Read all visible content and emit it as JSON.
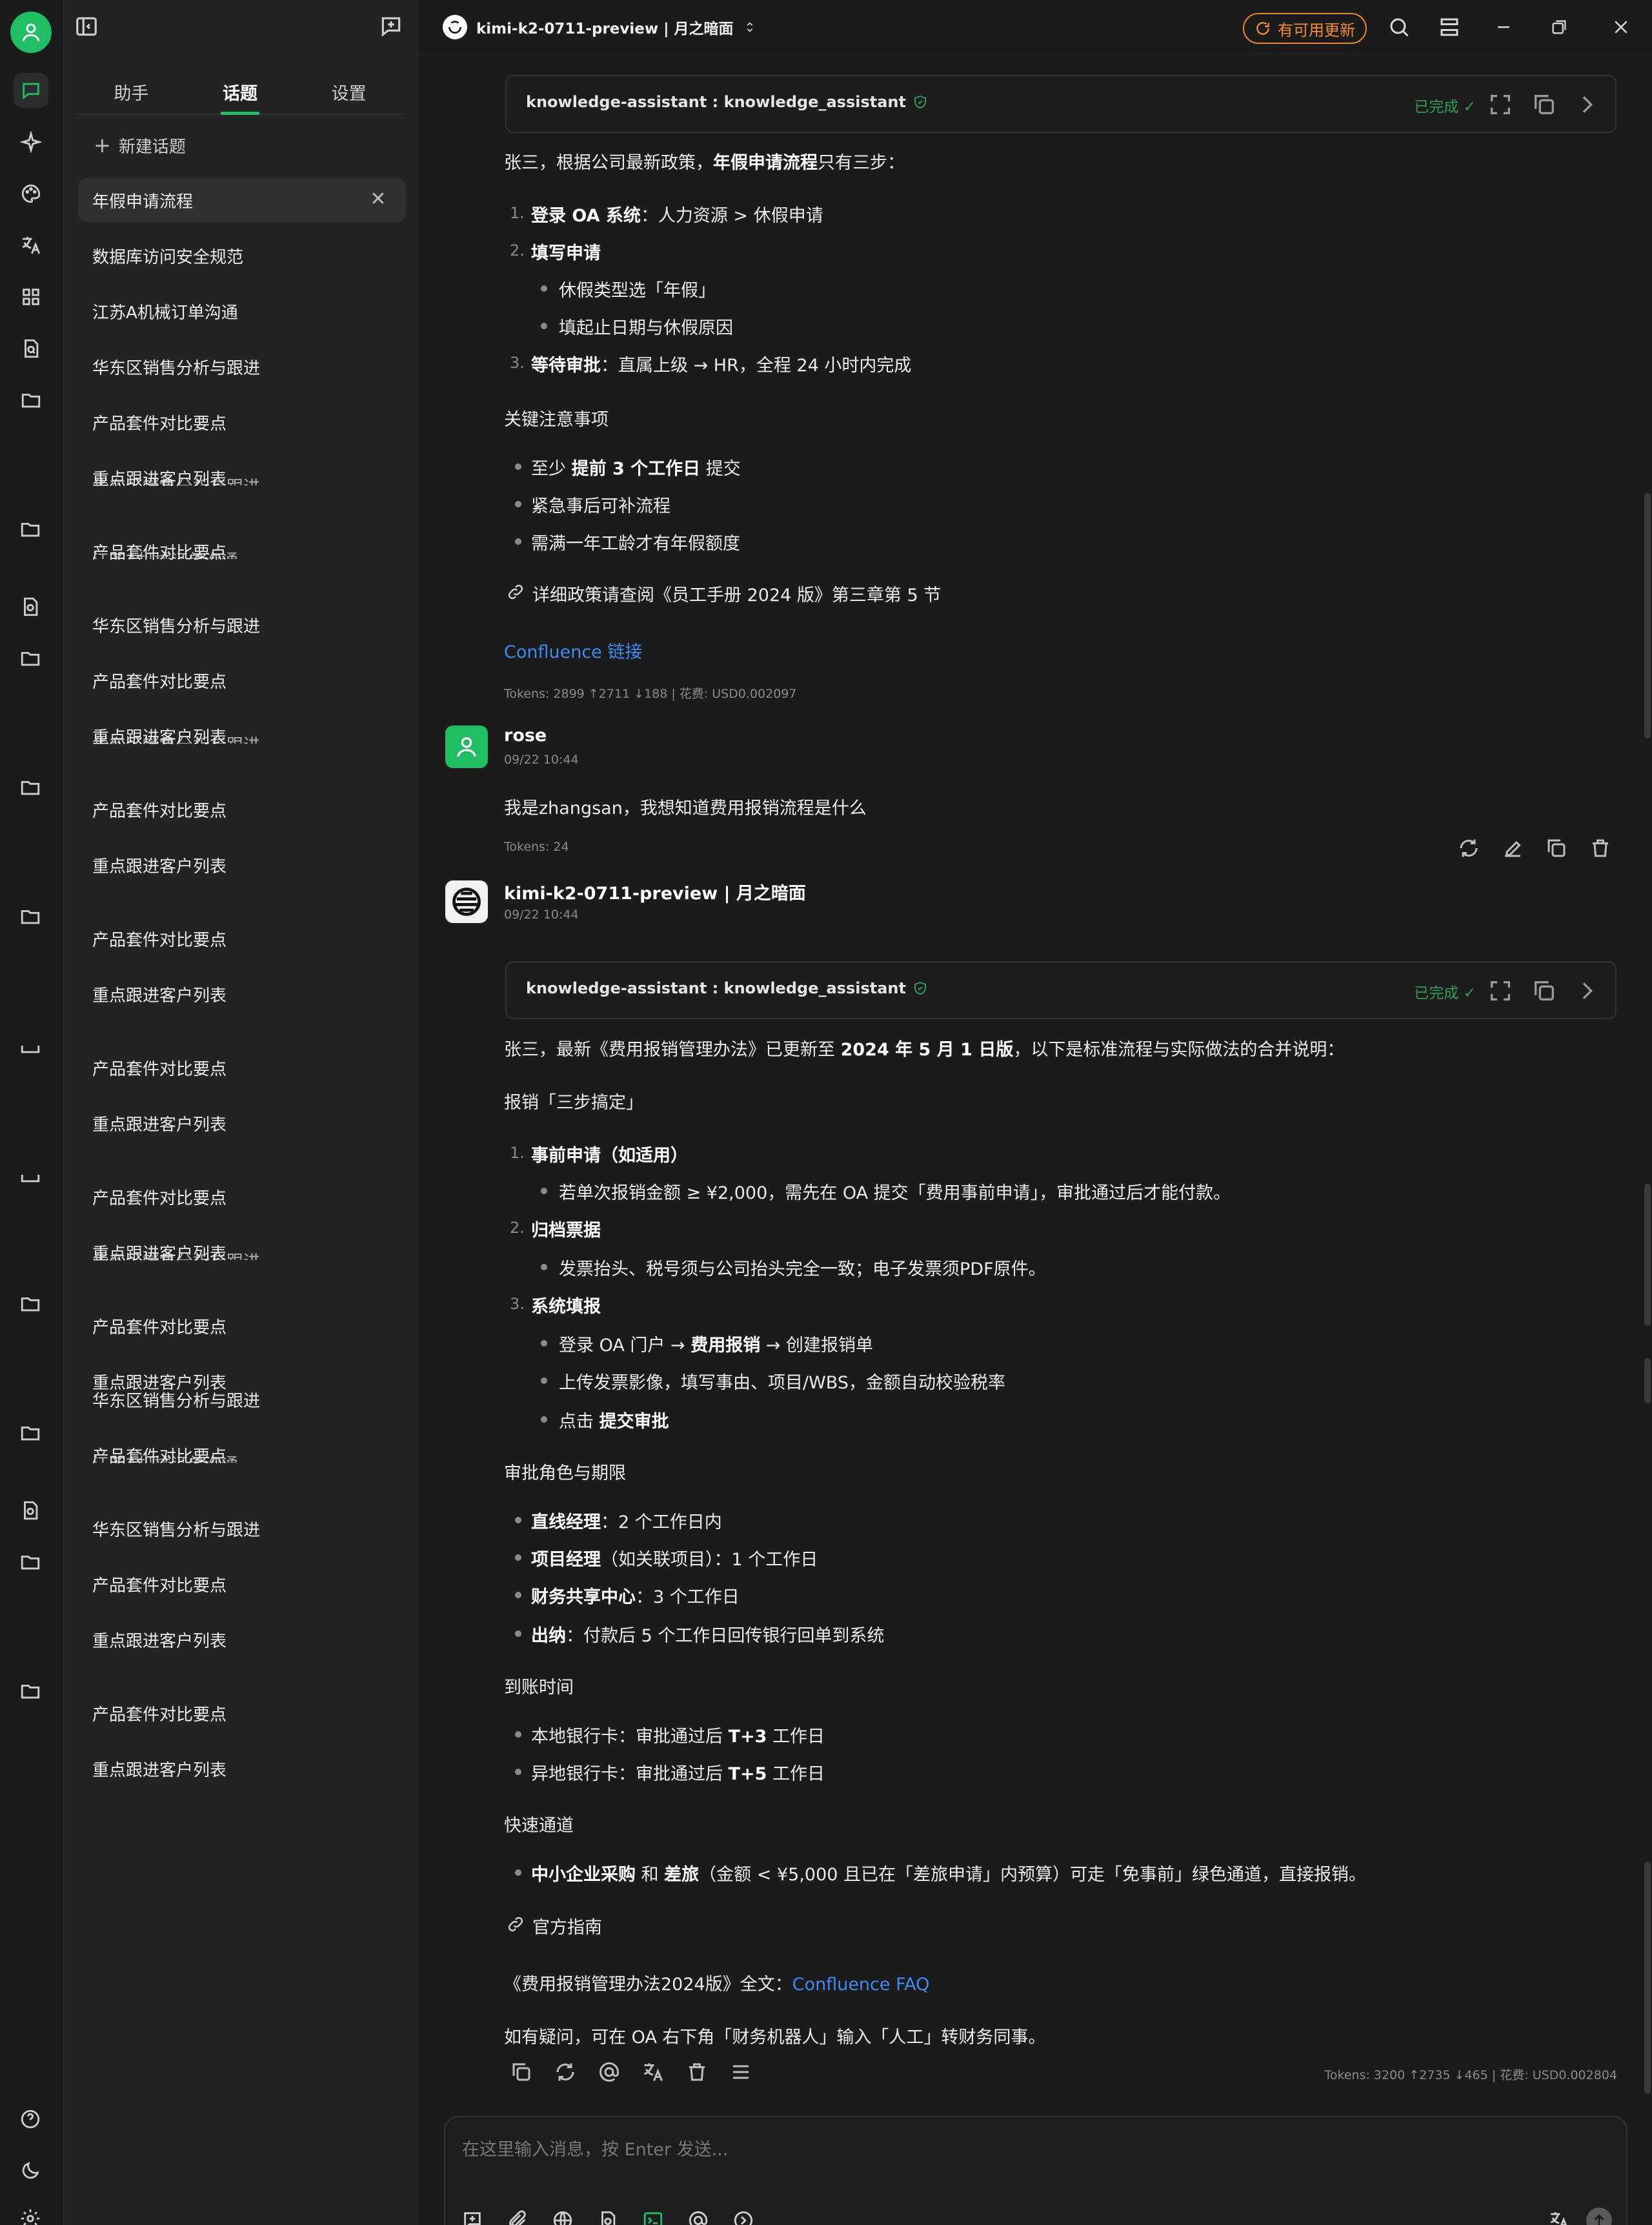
{
  "app": {
    "model_name": "kimi-k2-0711-preview | 月之暗面",
    "update_label": "有可用更新"
  },
  "sidebar_tabs": [
    "助手",
    "话题",
    "设置"
  ],
  "new_topic_label": "新建话题",
  "topics": [
    "年假申请流程",
    "数据库访问安全规范",
    "江苏A机械订单沟通",
    "华东区销售分析与跟进",
    "产品套件对比要点",
    "重点跟进客户列表",
    "华东区销售分析与跟进",
    "产品套件对比要点",
    "江苏A机械订单沟通",
    "华东区销售分析与跟进",
    "产品套件对比要点",
    "重点跟进客户列表",
    "华东区销售分析与跟进",
    "产品套件对比要点",
    "重点跟进客户列表",
    "产品套件对比要点",
    "重点跟进客户列表",
    "产品套件对比要点",
    "重点跟进客户列表",
    "产品套件对比要点",
    "重点跟进客户列表",
    "华东区销售分析与跟进",
    "产品套件对比要点",
    "重点跟进客户列表",
    "华东区销售分析与跟进",
    "产品套件对比要点",
    "江苏A机械订单沟通",
    "华东区销售分析与跟进",
    "产品套件对比要点",
    "重点跟进客户列表",
    "产品套件对比要点",
    "重点跟进客户列表"
  ],
  "tool_card": {
    "title": "knowledge-assistant : knowledge_assistant",
    "status": "已完成"
  },
  "msg1": {
    "intro_a": "张三，根据公司最新政策，",
    "intro_b": "年假申请流程",
    "intro_c": "只有三步：",
    "step1_num": "1.",
    "step1_b": "登录 OA 系统",
    "step1_t": "：人力资源 > 休假申请",
    "step2_num": "2.",
    "step2_b": "填写申请",
    "step2_sub1": "休假类型选「年假」",
    "step2_sub2": "填起止日期与休假原因",
    "step3_num": "3.",
    "step3_b": "等待审批",
    "step3_t": "：直属上级 → HR，全程 24 小时内完成",
    "notes_title": "关键注意事项",
    "note1_a": "至少 ",
    "note1_b": "提前 3 个工作日",
    "note1_c": " 提交",
    "note2": "紧急事后可补流程",
    "note3": "需满一年工龄才有年假额度",
    "policy_ref": "详细政策请查阅《员工手册 2024 版》第三章第 5 节",
    "confluence_link": "Confluence 链接",
    "tokens": "Tokens: 2899 ↑2711 ↓188 | 花费: USD0.002097"
  },
  "msg2": {
    "name": "rose",
    "time": "09/22 10:44",
    "text": "我是zhangsan，我想知道费用报销流程是什么",
    "tokens": "Tokens: 24"
  },
  "msg3": {
    "name": "kimi-k2-0711-preview | 月之暗面",
    "time": "09/22 10:44",
    "intro_a": "张三，最新《费用报销管理办法》已更新至 ",
    "intro_b": "2024 年 5 月 1 日版",
    "intro_c": "，以下是标准流程与实际做法的合并说明：",
    "section1": "报销「三步搞定」",
    "s1_num": "1.",
    "s1_b": "事前申请（如适用）",
    "s1_sub": "若单次报销金额 ≥ ¥2,000，需先在 OA 提交「费用事前申请」，审批通过后才能付款。",
    "s2_num": "2.",
    "s2_b": "归档票据",
    "s2_sub": "发票抬头、税号须与公司抬头完全一致；电子发票须PDF原件。",
    "s3_num": "3.",
    "s3_b": "系统填报",
    "s3_sub1_a": "登录 OA 门户 → ",
    "s3_sub1_b": "费用报销",
    "s3_sub1_c": " → 创建报销单",
    "s3_sub2": "上传发票影像，填写事由、项目/WBS，金额自动校验税率",
    "s3_sub3_a": "点击 ",
    "s3_sub3_b": "提交审批",
    "section2": "审批角色与期限",
    "r1_b": "直线经理",
    "r1_t": "：2 个工作日内",
    "r2_b": "项目经理",
    "r2_t": "（如关联项目）：1 个工作日",
    "r3_b": "财务共享中心",
    "r3_t": "：3 个工作日",
    "r4_b": "出纳",
    "r4_t": "：付款后 5 个工作日回传银行回单到系统",
    "section3": "到账时间",
    "a1_a": "本地银行卡：审批通过后 ",
    "a1_b": "T+3",
    "a1_c": " 工作日",
    "a2_a": "异地银行卡：审批通过后 ",
    "a2_b": "T+5",
    "a2_c": " 工作日",
    "section4": "快速通道",
    "f1_b1": "中小企业采购",
    "f1_t1": " 和 ",
    "f1_b2": "差旅",
    "f1_t2": "（金额 < ¥5,000 且已在「差旅申请」内预算）可走「免事前」绿色通道，直接报销。",
    "guide": "官方指南",
    "fulltext_a": "《费用报销管理办法2024版》全文：",
    "fulltext_link": "Confluence FAQ",
    "help": "如有疑问，可在 OA 右下角「财务机器人」输入「人工」转财务同事。",
    "tokens": "Tokens: 3200 ↑2735 ↓465 | 花费: USD0.002804"
  },
  "input": {
    "placeholder": "在这里输入消息，按 Enter 发送..."
  },
  "colors": {
    "accent_green": "#1fbe63",
    "update_orange": "#f28a2e",
    "link_blue": "#3d8bf2",
    "status_green": "#2e9c54"
  }
}
